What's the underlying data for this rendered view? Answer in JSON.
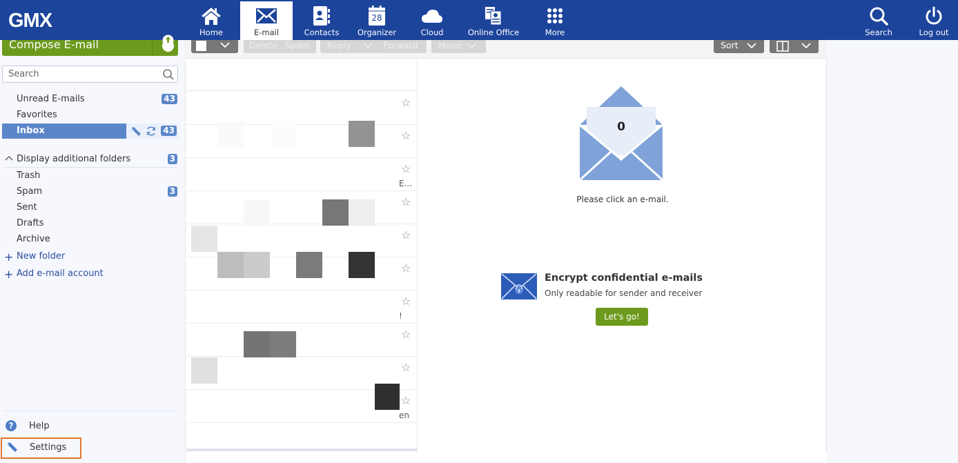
{
  "brand": {
    "logo": "GMX",
    "color": "#1c449b",
    "accent_green": "#6c9a1c",
    "highlight_orange": "#e4762a"
  },
  "nav": {
    "items": [
      {
        "id": "home",
        "label": "Home",
        "icon": "home-icon"
      },
      {
        "id": "email",
        "label": "E-mail",
        "icon": "envelope-icon",
        "active": true
      },
      {
        "id": "contacts",
        "label": "Contacts",
        "icon": "contacts-icon"
      },
      {
        "id": "organizer",
        "label": "Organizer",
        "icon": "calendar-icon",
        "calendar_day": "28"
      },
      {
        "id": "cloud",
        "label": "Cloud",
        "icon": "cloud-icon"
      },
      {
        "id": "office",
        "label": "Online Office",
        "icon": "documents-icon"
      },
      {
        "id": "more",
        "label": "More",
        "icon": "grid-icon"
      }
    ],
    "right": [
      {
        "id": "search",
        "label": "Search",
        "icon": "search-icon"
      },
      {
        "id": "logout",
        "label": "Log out",
        "icon": "power-icon"
      }
    ]
  },
  "sidebar": {
    "compose_label": "Compose E-mail",
    "search_placeholder": "Search",
    "folders": [
      {
        "name": "Unread E-mails",
        "count": "43"
      },
      {
        "name": "Favorites",
        "count": null
      },
      {
        "name": "Inbox",
        "count": "43",
        "selected": true
      }
    ],
    "additional": {
      "label": "Display additional folders",
      "count": "3"
    },
    "extra_folders": [
      {
        "name": "Trash",
        "count": null
      },
      {
        "name": "Spam",
        "count": "3"
      },
      {
        "name": "Sent",
        "count": null
      },
      {
        "name": "Drafts",
        "count": null
      },
      {
        "name": "Archive",
        "count": null
      }
    ],
    "new_folder": "New folder",
    "add_account": "Add e-mail account",
    "help": "Help",
    "settings": "Settings"
  },
  "toolbar": {
    "delete": "Delete",
    "spam": "Spam",
    "reply": "Reply",
    "forward": "Forward",
    "move": "Move",
    "sort": "Sort"
  },
  "list": {
    "snippets": [
      "",
      "",
      "E...",
      "",
      "",
      "",
      "!",
      "",
      "",
      "en"
    ]
  },
  "reader": {
    "count": "0",
    "placeholder": "Please click an e-mail.",
    "promo_title": "Encrypt confidential e-mails",
    "promo_sub": "Only readable for sender and receiver",
    "promo_button": "Let's go!"
  }
}
